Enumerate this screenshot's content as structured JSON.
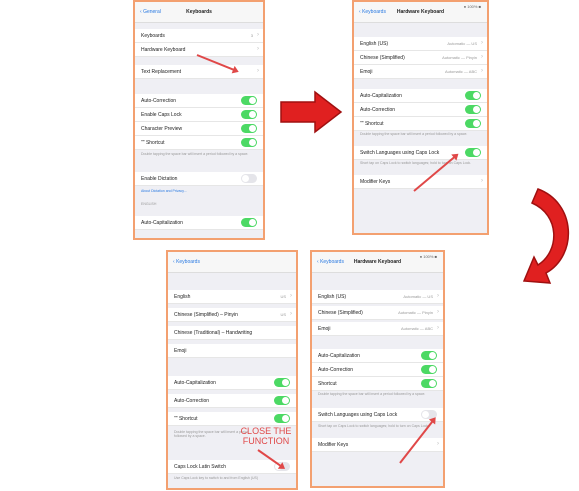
{
  "panel1": {
    "back": "General",
    "title": "Keyboards",
    "rows": [
      {
        "label": "Keyboards",
        "value": "3"
      },
      {
        "label": "Hardware Keyboard"
      },
      {
        "label": "Text Replacement"
      },
      {
        "label": "Auto-Correction"
      },
      {
        "label": "Enable Caps Lock"
      },
      {
        "label": "Character Preview"
      },
      {
        "label": "\"\" Shortcut"
      },
      {
        "label": "Enable Dictation"
      },
      {
        "label": "Auto-Capitalization"
      }
    ],
    "shortcut_note": "Double tapping the space bar will insert a period followed by a space.",
    "dictation_link": "About Dictation and Privacy...",
    "section_header": "ENGLISH"
  },
  "panel2": {
    "back": "Keyboards",
    "title": "Hardware Keyboard",
    "status": "● 100% ■",
    "rows": [
      {
        "label": "English (US)",
        "value": "Automatic — US"
      },
      {
        "label": "Chinese (Simplified)",
        "value": "Automatic — Pinyin"
      },
      {
        "label": "Emoji",
        "value": "Automatic — ABC"
      },
      {
        "label": "Auto-Capitalization"
      },
      {
        "label": "Auto-Correction"
      },
      {
        "label": "\"\" Shortcut"
      },
      {
        "label": "Switch Languages using Caps Lock"
      },
      {
        "label": "Modifier Keys"
      }
    ],
    "shortcut_note": "Double tapping the space bar will insert a period followed by a space.",
    "caps_note": "Short tap on Caps Lock to switch languages; hold to turn on Caps Lock."
  },
  "panel3": {
    "back": "Keyboards",
    "rows": [
      {
        "label": "English",
        "value": "US"
      },
      {
        "label": "Chinese (Simplified) – Pinyin",
        "value": "US"
      },
      {
        "label": "Chinese (Traditional) – Handwriting"
      },
      {
        "label": "Emoji"
      },
      {
        "label": "Auto-Capitalization"
      },
      {
        "label": "Auto-Correction"
      },
      {
        "label": "\"\" Shortcut"
      },
      {
        "label": "Caps Lock Latin Switch"
      }
    ],
    "shortcut_note": "Double tapping the space bar will insert a period followed by a space.",
    "caps_note": "Use Caps Lock key to switch to and from English (US)",
    "callout": "CLOSE THE FUNCTION"
  },
  "panel4": {
    "back": "Keyboards",
    "title": "Hardware Keyboard",
    "status": "● 100% ■",
    "rows": [
      {
        "label": "English (US)",
        "value": "Automatic — US"
      },
      {
        "label": "Chinese (Simplified)",
        "value": "Automatic — Pinyin"
      },
      {
        "label": "Emoji",
        "value": "Automatic — ABC"
      },
      {
        "label": "Auto-Capitalization"
      },
      {
        "label": "Auto-Correction"
      },
      {
        "label": "Shortcut"
      },
      {
        "label": "Switch Languages using Caps Lock"
      },
      {
        "label": "Modifier Keys"
      }
    ],
    "shortcut_note": "Double tapping the space bar will insert a period followed by a space.",
    "caps_note": "Short tap on Caps Lock to switch languages; hold to turn on Caps Lock."
  },
  "colors": {
    "frame": "#f3a070",
    "arrow": "#e02020",
    "toggle_on": "#4cd964",
    "link": "#2a7ae2"
  }
}
